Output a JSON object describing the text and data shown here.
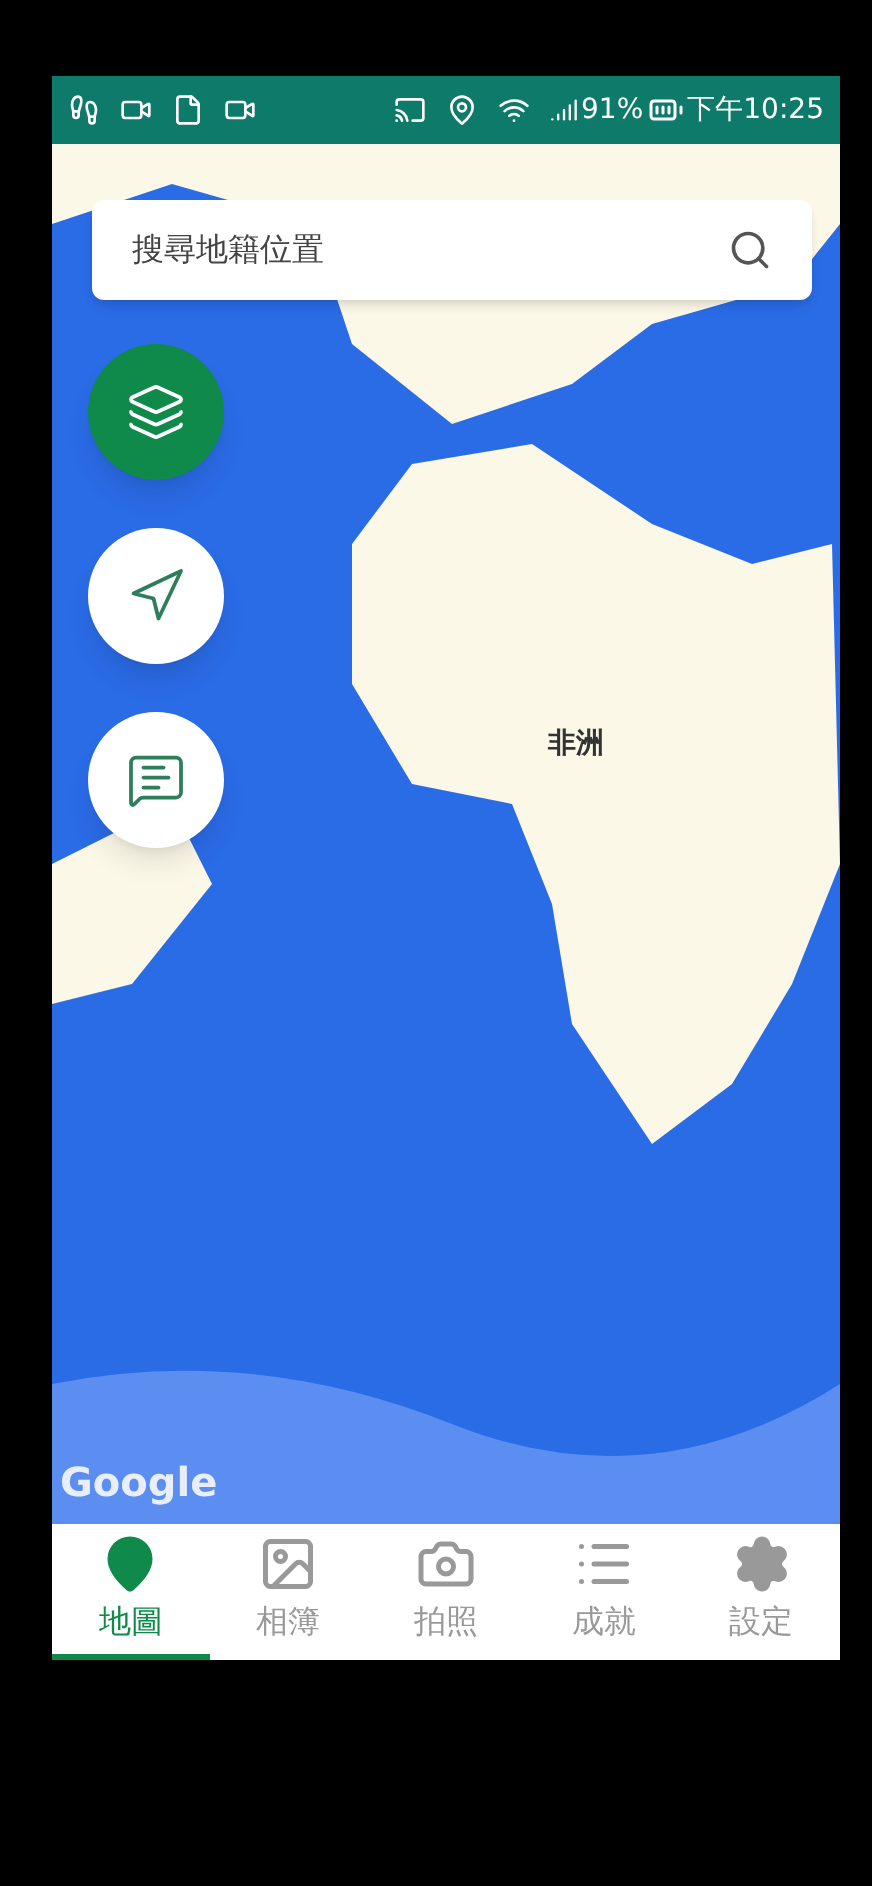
{
  "status_bar": {
    "battery": "91%",
    "time": "下午10:25"
  },
  "search": {
    "placeholder": "搜尋地籍位置"
  },
  "map": {
    "labels": [
      "非洲"
    ],
    "attribution": "Google"
  },
  "map_buttons": [
    {
      "kind": "layers",
      "selected": true
    },
    {
      "kind": "locate",
      "selected": false
    },
    {
      "kind": "chat",
      "selected": false
    }
  ],
  "bottom_nav": [
    {
      "kind": "map",
      "label": "地圖",
      "selected": true
    },
    {
      "kind": "album",
      "label": "相簿",
      "selected": false
    },
    {
      "kind": "camera",
      "label": "拍照",
      "selected": false
    },
    {
      "kind": "list",
      "label": "成就",
      "selected": false
    },
    {
      "kind": "settings",
      "label": "設定",
      "selected": false
    }
  ]
}
